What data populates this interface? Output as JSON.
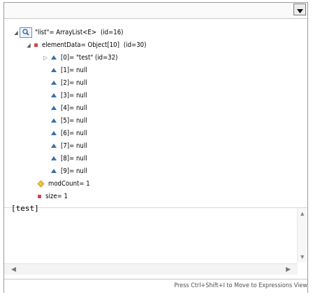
{
  "variables": {
    "root": {
      "name": "\"list\"= ArrayList<E>",
      "id": "(id=16)"
    },
    "elementData": {
      "label": "elementData= Object[10]",
      "id": "(id=30)"
    },
    "items": [
      {
        "label": "[0]= \"test\" (id=32)",
        "expandable": true
      },
      {
        "label": "[1]= null",
        "expandable": false
      },
      {
        "label": "[2]= null",
        "expandable": false
      },
      {
        "label": "[3]= null",
        "expandable": false
      },
      {
        "label": "[4]= null",
        "expandable": false
      },
      {
        "label": "[5]= null",
        "expandable": false
      },
      {
        "label": "[6]= null",
        "expandable": false
      },
      {
        "label": "[7]= null",
        "expandable": false
      },
      {
        "label": "[8]= null",
        "expandable": false
      },
      {
        "label": "[9]= null",
        "expandable": false
      }
    ],
    "modCount": "modCount= 1",
    "size": "size= 1"
  },
  "detail": {
    "text": "[test]"
  },
  "status": {
    "hint": "Press Ctrl+Shift+I to Move to Expressions View"
  },
  "icons": {
    "dropdown": "chevron-down-icon",
    "search": "search-icon",
    "field": "triangle-field-icon",
    "private_field": "square-field-icon",
    "package_field": "diamond-field-icon"
  }
}
